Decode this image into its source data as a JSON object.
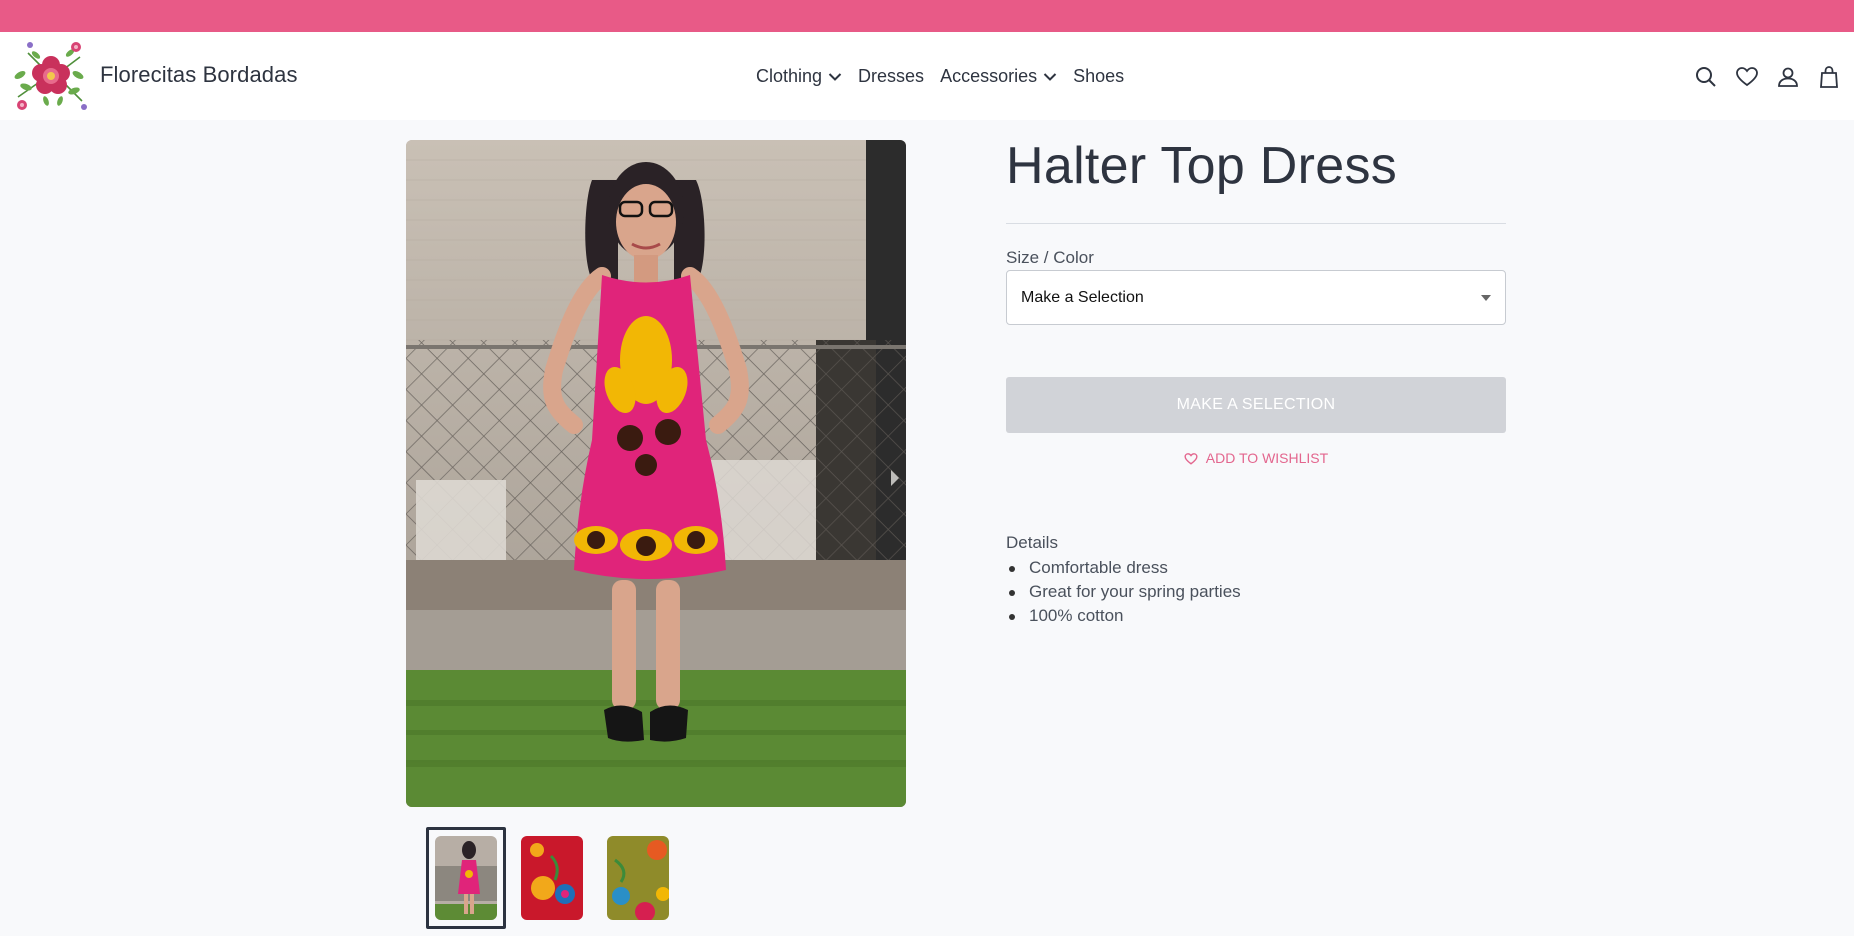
{
  "colors": {
    "announcement_bar": "#e85a87",
    "accent": "#e3668e",
    "cta_disabled": "#d1d3d8"
  },
  "header": {
    "brand": "Florecitas Bordadas",
    "logo_icon": "flower-embroidery-logo",
    "nav": [
      {
        "label": "Clothing",
        "has_dropdown": true
      },
      {
        "label": "Dresses",
        "has_dropdown": false
      },
      {
        "label": "Accessories",
        "has_dropdown": true
      },
      {
        "label": "Shoes",
        "has_dropdown": false
      }
    ],
    "icons": [
      "search-icon",
      "heart-icon",
      "user-icon",
      "bag-icon"
    ]
  },
  "product": {
    "title": "Halter Top Dress",
    "size_color_label": "Size / Color",
    "select_value": "Make a Selection",
    "cta_label": "MAKE A SELECTION",
    "wishlist_label": "ADD TO WISHLIST",
    "details_title": "Details",
    "details": [
      "Comfortable dress",
      "Great for your spring parties",
      "100% cotton"
    ]
  },
  "gallery": {
    "thumbnail_count": 3,
    "active_thumbnail": 1
  }
}
